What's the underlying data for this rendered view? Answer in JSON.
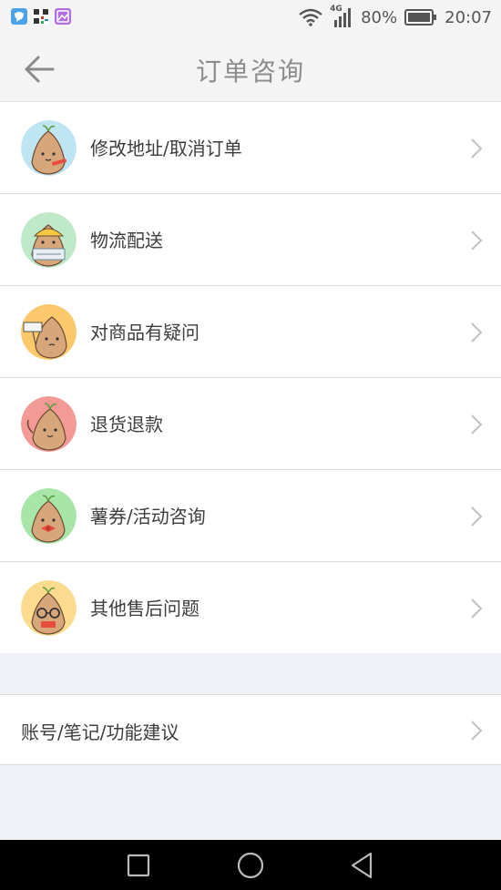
{
  "status_bar": {
    "network": "4G",
    "battery": "80%",
    "time": "20:07",
    "notification_icons": [
      "messenger-icon",
      "qr-code-icon",
      "gallery-icon"
    ]
  },
  "header": {
    "title": "订单咨询",
    "back_icon": "arrow-left-icon"
  },
  "menu": {
    "items": [
      {
        "label": "修改地址/取消订单",
        "avatar_bg": "#bfe4f2"
      },
      {
        "label": "物流配送",
        "avatar_bg": "#bfe9c9"
      },
      {
        "label": "对商品有疑问",
        "avatar_bg": "#fbc96b"
      },
      {
        "label": "退货退款",
        "avatar_bg": "#f49a96"
      },
      {
        "label": "薯券/活动咨询",
        "avatar_bg": "#a8e5a9"
      },
      {
        "label": "其他售后问题",
        "avatar_bg": "#fbdb8e"
      }
    ]
  },
  "feedback": {
    "label": "账号/笔记/功能建议"
  },
  "nav_bar": {
    "buttons": [
      "recent-apps-icon",
      "home-icon",
      "back-triangle-icon"
    ]
  }
}
